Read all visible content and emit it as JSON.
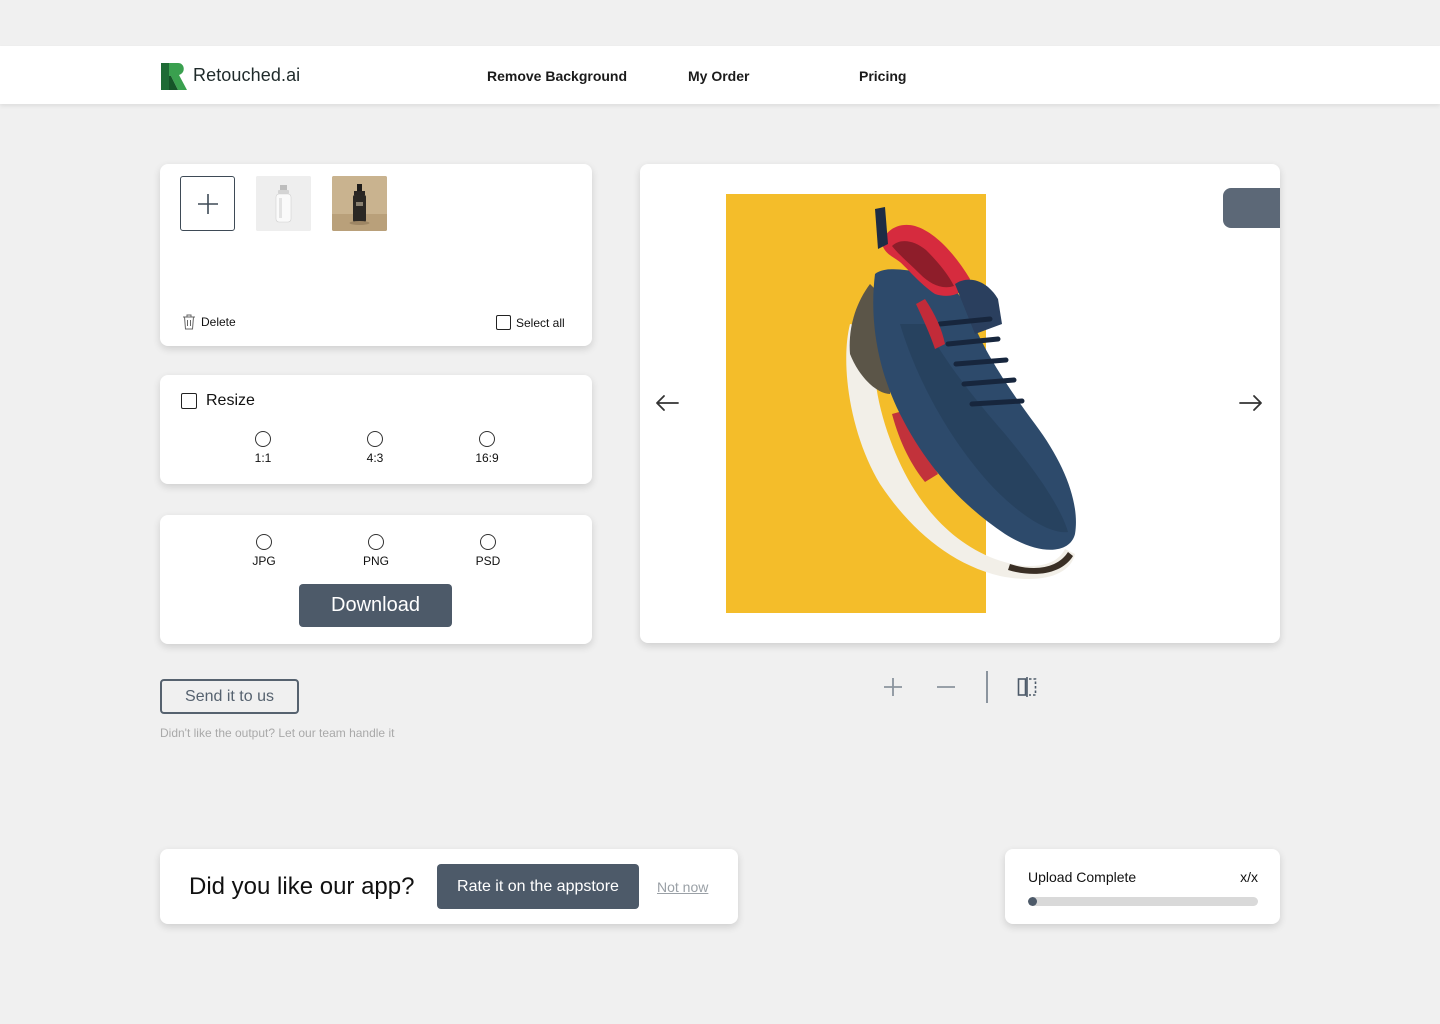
{
  "brand": {
    "name": "Retouched.ai",
    "color": "#2f8a3e"
  },
  "nav": {
    "remove_background": "Remove Background",
    "my_order": "My Order",
    "pricing": "Pricing"
  },
  "gallery": {
    "thumbnails": [
      {
        "name": "white bottle product"
      },
      {
        "name": "dark bottle product"
      }
    ],
    "delete_label": "Delete",
    "select_all_label": "Select all"
  },
  "resize": {
    "label": "Resize",
    "options": [
      "1:1",
      "4:3",
      "16:9"
    ]
  },
  "format": {
    "options": [
      "JPG",
      "PNG",
      "PSD"
    ],
    "download_label": "Download"
  },
  "support": {
    "send_label": "Send it to us",
    "hint": "Didn't like the output? Let our team handle it"
  },
  "rating": {
    "question": "Did you like our app?",
    "rate_label": "Rate it on the appstore",
    "not_now_label": "Not now"
  },
  "upload": {
    "title": "Upload Complete",
    "count": "x/x",
    "progress": 0.03
  },
  "colors": {
    "accent": "#4d5a69",
    "preview_background": "#f4bd2a",
    "page_background": "#f0f0f0"
  }
}
